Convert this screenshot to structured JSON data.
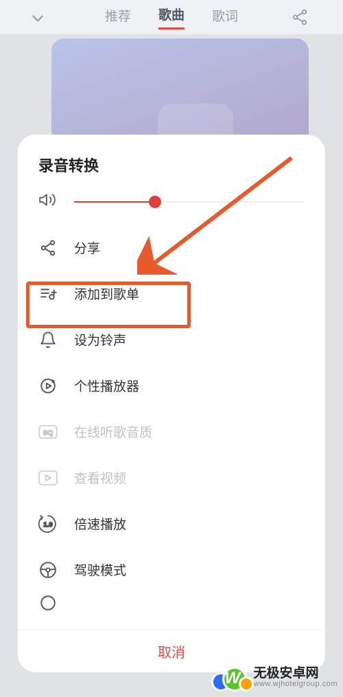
{
  "header": {
    "tabs": [
      "推荐",
      "歌曲",
      "歌词"
    ],
    "active_index": 1
  },
  "sheet": {
    "title": "录音转换",
    "volume": {
      "level_percent": 35
    },
    "items": [
      {
        "id": "share",
        "label": "分享",
        "icon": "share-icon",
        "disabled": false
      },
      {
        "id": "add-playlist",
        "label": "添加到歌单",
        "icon": "add-playlist-icon",
        "disabled": false,
        "highlighted": true
      },
      {
        "id": "ringtone",
        "label": "设为铃声",
        "icon": "bell-icon",
        "disabled": false
      },
      {
        "id": "player-skin",
        "label": "个性播放器",
        "icon": "player-skin-icon",
        "disabled": false
      },
      {
        "id": "quality",
        "label": "在线听歌音质",
        "icon": "sq-quality-icon",
        "disabled": true
      },
      {
        "id": "video",
        "label": "查看视频",
        "icon": "video-icon",
        "disabled": true
      },
      {
        "id": "speed",
        "label": "倍速播放",
        "icon": "speed-icon",
        "disabled": false
      },
      {
        "id": "driving",
        "label": "驾驶模式",
        "icon": "steering-icon",
        "disabled": false
      }
    ],
    "cancel_label": "取消"
  },
  "annotation": {
    "type": "arrow_and_box",
    "target_id": "add-playlist",
    "arrow_color": "#e85a2c"
  },
  "watermark": {
    "logo_letter": "W",
    "title": "无极安卓网",
    "subtitle": "www.wjhotelgroup.com"
  }
}
